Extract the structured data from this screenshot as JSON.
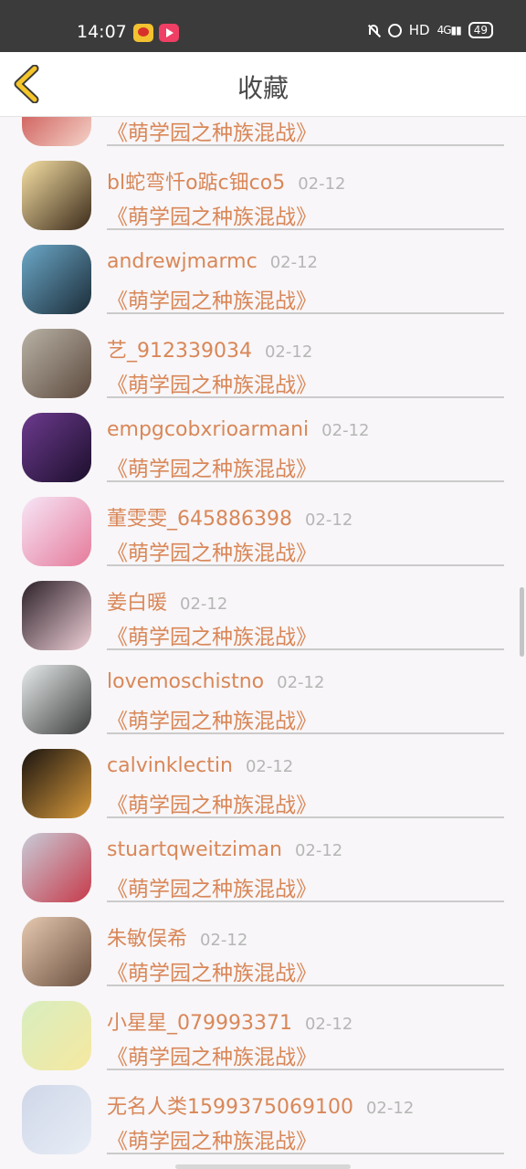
{
  "status_bar": {
    "time": "14:07",
    "hd": "HD",
    "signal": "4G",
    "battery": "49"
  },
  "header": {
    "title": "收藏",
    "back_icon": "chevron-left-icon"
  },
  "items": [
    {
      "name": "",
      "date": "",
      "work": "《萌学园之种族混战》",
      "avatar": "avatar-anime-red",
      "colors": [
        "#c43b3b",
        "#f4d3c8"
      ]
    },
    {
      "name": "bl蛇弯忏o踮c钿co5",
      "date": "02-12",
      "work": "《萌学园之种族混战》",
      "avatar": "avatar-giraffe",
      "colors": [
        "#f6e0a4",
        "#3b2a1a"
      ]
    },
    {
      "name": "andrewjmarmc",
      "date": "02-12",
      "work": "《萌学园之种族混战》",
      "avatar": "avatar-underwater",
      "colors": [
        "#6ca8c8",
        "#1b2c38"
      ]
    },
    {
      "name": "艺_912339034",
      "date": "02-12",
      "work": "《萌学园之种族混战》",
      "avatar": "avatar-girl-flowers",
      "colors": [
        "#b9b2a6",
        "#5d4a3e"
      ]
    },
    {
      "name": "empgcobxrioarmani",
      "date": "02-12",
      "work": "《萌学园之种族混战》",
      "avatar": "avatar-silhouette-purple",
      "colors": [
        "#6c3a8e",
        "#1c0f2c"
      ]
    },
    {
      "name": "董雯雯_645886398",
      "date": "02-12",
      "work": "《萌学园之种族混战》",
      "avatar": "avatar-bunny-strawberry",
      "colors": [
        "#f7e6f7",
        "#e57a9a"
      ]
    },
    {
      "name": "姜白暖",
      "date": "02-12",
      "work": "《萌学园之种族混战》",
      "avatar": "avatar-girl-portrait",
      "colors": [
        "#2c2028",
        "#f0d0d8"
      ]
    },
    {
      "name": "lovemoschistno",
      "date": "02-12",
      "work": "《萌学园之种族混战》",
      "avatar": "avatar-girl-white",
      "colors": [
        "#e8ecec",
        "#3c3c3c"
      ]
    },
    {
      "name": "calvinklectin",
      "date": "02-12",
      "work": "《萌学园之种族混战》",
      "avatar": "avatar-candles",
      "colors": [
        "#1a1410",
        "#d89a3c"
      ]
    },
    {
      "name": "stuartqweitziman",
      "date": "02-12",
      "work": "《萌学园之种族混战》",
      "avatar": "avatar-girl-heart",
      "colors": [
        "#c8ccd8",
        "#c73a4a"
      ]
    },
    {
      "name": "朱敏俣希",
      "date": "02-12",
      "work": "《萌学园之种族混战》",
      "avatar": "avatar-girl-sunlight",
      "colors": [
        "#e7c9b0",
        "#6a5040"
      ]
    },
    {
      "name": "小星星_079993371",
      "date": "02-12",
      "work": "《萌学园之种族混战》",
      "avatar": "avatar-anime-blonde",
      "colors": [
        "#d8eec0",
        "#f6e8a0"
      ]
    },
    {
      "name": "无名人类1599375069100",
      "date": "02-12",
      "work": "《萌学园之种族混战》",
      "avatar": "avatar-default-person",
      "colors": [
        "#cfd7e8",
        "#e8edf6"
      ]
    }
  ]
}
